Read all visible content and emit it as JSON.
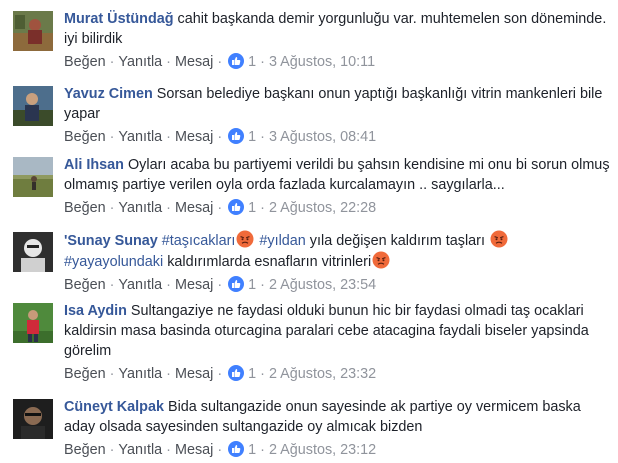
{
  "comments": [
    {
      "author": "Murat Üstündağ",
      "text": "cahit başkanda demir yorgunluğu var. muhtemelen son döneminde. iyi bilirdik",
      "like_label": "Beğen",
      "reply_label": "Yanıtla",
      "message_label": "Mesaj",
      "like_count": "1",
      "time": "3 Ağustos, 10:11"
    },
    {
      "author": "Yavuz Cimen",
      "text": "Sorsan belediye başkanı onun yaptığı başkanlığı vitrin mankenleri bile yapar",
      "like_label": "Beğen",
      "reply_label": "Yanıtla",
      "message_label": "Mesaj",
      "like_count": "1",
      "time": "3 Ağustos, 08:41"
    },
    {
      "author": "Ali Ihsan",
      "text": "Oyları acaba bu partiyemi verildi bu şahsın kendisine mi onu bi sorun olmuş olmamış partiye verilen oyla orda fazlada kurcalamayın .. saygılarla...",
      "like_label": "Beğen",
      "reply_label": "Yanıtla",
      "message_label": "Mesaj",
      "like_count": "1",
      "time": "2 Ağustos, 22:28"
    },
    {
      "author": "'Sunay Sunay",
      "hashtag1": "#taşıcakları",
      "hashtag2": "#yıldan",
      "text_a": "yıla değişen kaldırım taşları",
      "hashtag3": "#yayayolundaki",
      "text_b": "kaldırımlarda esnafların vitrinleri",
      "like_label": "Beğen",
      "reply_label": "Yanıtla",
      "message_label": "Mesaj",
      "like_count": "1",
      "time": "2 Ağustos, 23:54"
    },
    {
      "author": "Isa Aydin",
      "text": "Sultangaziye ne faydasi olduki bunun hic bir faydasi olmadi taş ocaklari kaldirsin masa basinda oturcagina paralari cebe atacagina faydali biseler yapsinda görelim",
      "like_label": "Beğen",
      "reply_label": "Yanıtla",
      "message_label": "Mesaj",
      "like_count": "1",
      "time": "2 Ağustos, 23:32"
    },
    {
      "author": "Cüneyt Kalpak",
      "text": "Bida sultangazide onun sayesinde ak partiye oy vermicem baska aday olsada sayesinden sultangazide oy almıcak bizden",
      "like_label": "Beğen",
      "reply_label": "Yanıtla",
      "message_label": "Mesaj",
      "like_count": "1",
      "time": "2 Ağustos, 23:12"
    }
  ],
  "colors": {
    "link": "#365899",
    "meta": "#90949c",
    "action": "#4b4f56",
    "like_badge": "#4080ff",
    "text": "#1d2129"
  }
}
